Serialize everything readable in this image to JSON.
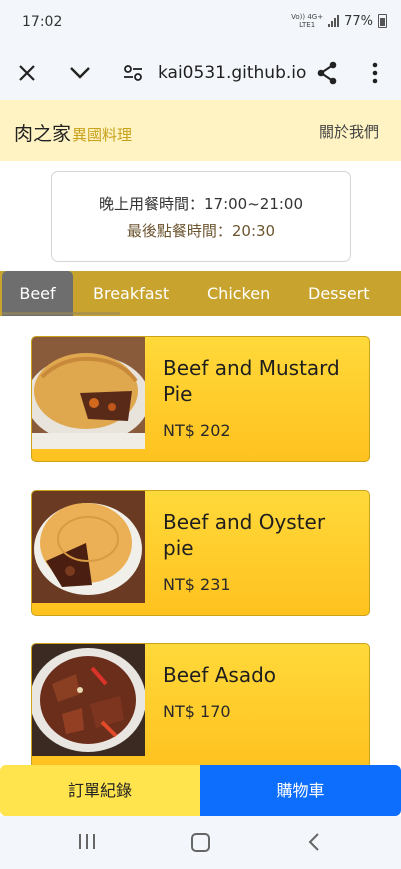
{
  "status_bar": {
    "time": "17:02",
    "network_top": "Vo)) 4G+",
    "network_bottom": "LTE1",
    "battery": "77%"
  },
  "browser": {
    "url": "kai0531.github.io",
    "icons": [
      "close-icon",
      "chevron-down-icon",
      "site-settings-icon",
      "share-icon",
      "more-vert-icon"
    ]
  },
  "header": {
    "logo_main": "肉之家",
    "logo_sub": "異國料理",
    "about_link": "關於我們"
  },
  "hours": {
    "line1": "晚上用餐時間：17:00~21:00",
    "line2": "最後點餐時間：20:30"
  },
  "tabs": [
    {
      "label": "Beef",
      "active": true
    },
    {
      "label": "Breakfast",
      "active": false
    },
    {
      "label": "Chicken",
      "active": false
    },
    {
      "label": "Dessert",
      "active": false
    }
  ],
  "menu_items": [
    {
      "name": "Beef and Mustard Pie",
      "price": "NT$ 202"
    },
    {
      "name": "Beef and Oyster pie",
      "price": "NT$ 231"
    },
    {
      "name": "Beef Asado",
      "price": "NT$ 170"
    }
  ],
  "bottom_bar": {
    "orders": "訂單紀錄",
    "cart": "購物車"
  },
  "colors": {
    "header_bg": "#fff3c4",
    "tabs_bg": "#c8a42f",
    "active_tab": "#6e6e6e",
    "card_bg": "#ffc21f",
    "cart_button": "#0d6efd",
    "orders_button": "#ffe44d"
  }
}
